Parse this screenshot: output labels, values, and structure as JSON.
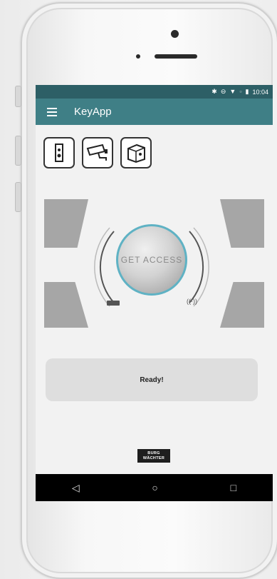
{
  "status_bar": {
    "time": "10:04",
    "icons": [
      "bluetooth-icon",
      "do-not-disturb-icon",
      "wifi-icon",
      "no-sim-icon",
      "battery-icon"
    ]
  },
  "app_bar": {
    "title": "KeyApp",
    "menu_icon": "hamburger-menu-icon"
  },
  "device_types": [
    {
      "name": "door-lock",
      "icon": "door-lock-icon"
    },
    {
      "name": "camera",
      "icon": "security-camera-icon"
    },
    {
      "name": "safe",
      "icon": "safe-box-icon"
    }
  ],
  "access_button": {
    "label": "GET ACCESS",
    "ring_color": "#5fb2c4"
  },
  "indicators": {
    "battery_icon": "battery-icon",
    "signal_icon": "wireless-signal-icon",
    "signal_text": "((·))"
  },
  "status_message": "Ready!",
  "brand_logo": {
    "line1": "BURG",
    "line2": "WÄCHTER"
  },
  "nav_bar": {
    "back": "◁",
    "home": "○",
    "recents": "□"
  },
  "colors": {
    "status_bar": "#2d5f66",
    "app_bar": "#3f7f86",
    "background": "#f2f2f2",
    "corner_blocks": "#a6a6a6"
  }
}
